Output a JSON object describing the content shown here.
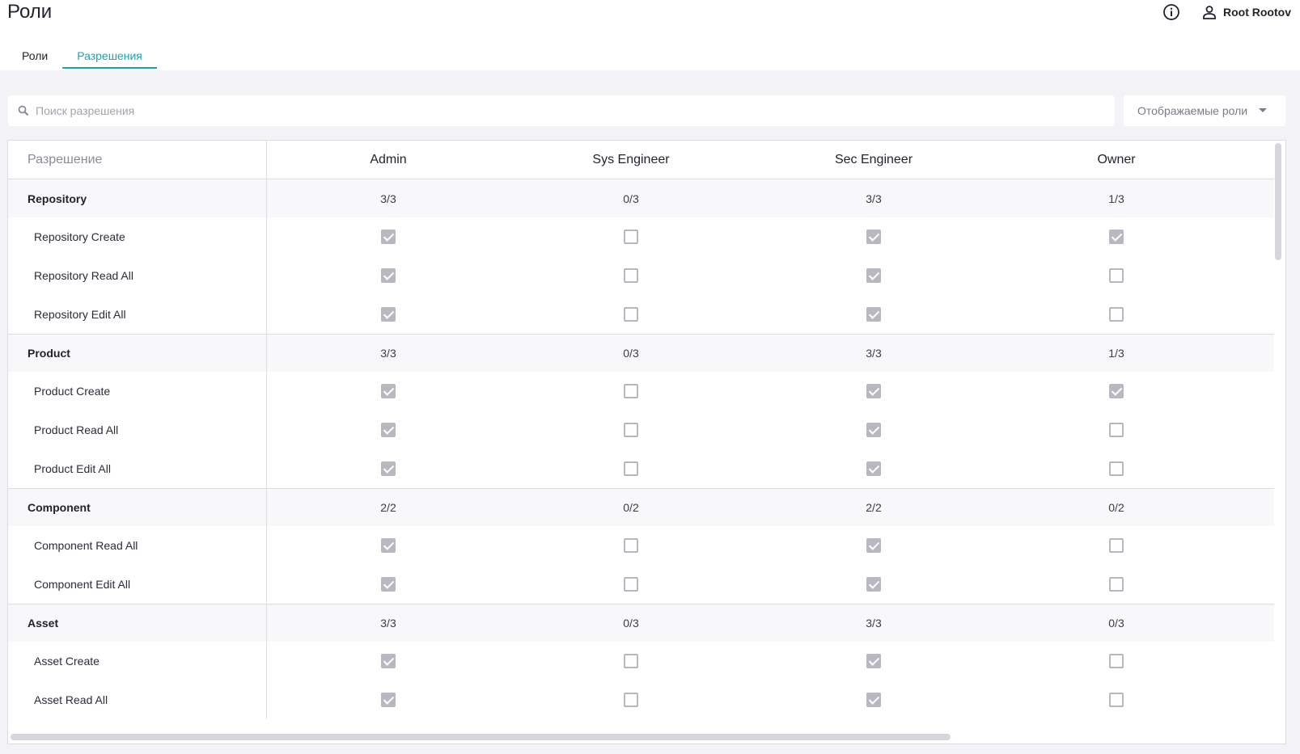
{
  "page": {
    "title": "Роли"
  },
  "header": {
    "user_name": "Root Rootov"
  },
  "tabs": [
    {
      "label": "Роли",
      "active": false
    },
    {
      "label": "Разрешения",
      "active": true
    }
  ],
  "search": {
    "placeholder": "Поиск разрешения",
    "value": ""
  },
  "roles_filter": {
    "label": "Отображаемые роли"
  },
  "table": {
    "permission_header": "Разрешение",
    "roles": [
      "Admin",
      "Sys Engineer",
      "Sec Engineer",
      "Owner"
    ],
    "groups": [
      {
        "name": "Repository",
        "counts": [
          "3/3",
          "0/3",
          "3/3",
          "1/3"
        ],
        "permissions": [
          {
            "name": "Repository Create",
            "checked": [
              true,
              false,
              true,
              true
            ]
          },
          {
            "name": "Repository Read All",
            "checked": [
              true,
              false,
              true,
              false
            ]
          },
          {
            "name": "Repository Edit All",
            "checked": [
              true,
              false,
              true,
              false
            ]
          }
        ]
      },
      {
        "name": "Product",
        "counts": [
          "3/3",
          "0/3",
          "3/3",
          "1/3"
        ],
        "permissions": [
          {
            "name": "Product Create",
            "checked": [
              true,
              false,
              true,
              true
            ]
          },
          {
            "name": "Product Read All",
            "checked": [
              true,
              false,
              true,
              false
            ]
          },
          {
            "name": "Product Edit All",
            "checked": [
              true,
              false,
              true,
              false
            ]
          }
        ]
      },
      {
        "name": "Component",
        "counts": [
          "2/2",
          "0/2",
          "2/2",
          "0/2"
        ],
        "permissions": [
          {
            "name": "Component Read All",
            "checked": [
              true,
              false,
              true,
              false
            ]
          },
          {
            "name": "Component Edit All",
            "checked": [
              true,
              false,
              true,
              false
            ]
          }
        ]
      },
      {
        "name": "Asset",
        "counts": [
          "3/3",
          "0/3",
          "3/3",
          "0/3"
        ],
        "permissions": [
          {
            "name": "Asset Create",
            "checked": [
              true,
              false,
              true,
              false
            ]
          },
          {
            "name": "Asset Read All",
            "checked": [
              true,
              false,
              true,
              false
            ]
          }
        ]
      }
    ]
  },
  "icons": {
    "info": "info-circle-icon",
    "user": "user-icon",
    "search": "search-icon",
    "dropdown": "caret-down-icon"
  },
  "colors": {
    "accent": "#15a5b6",
    "checkbox": "#b8b8c2",
    "background": "#f3f3f7"
  }
}
